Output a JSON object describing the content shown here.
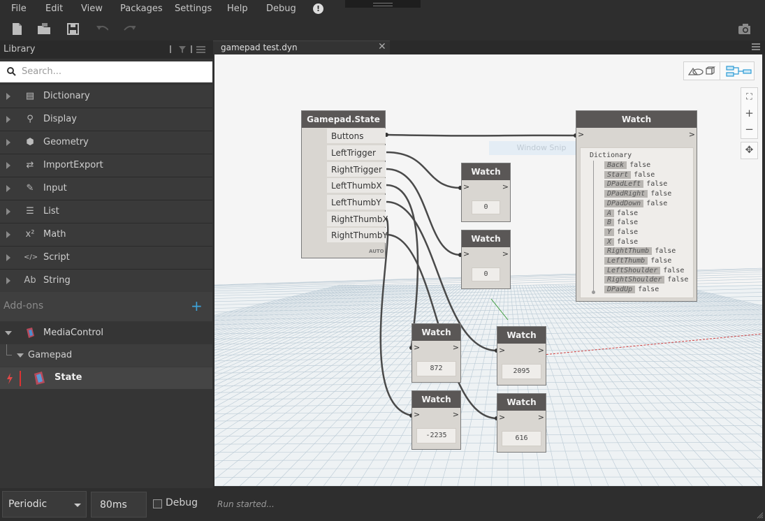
{
  "menu": {
    "items": [
      "File",
      "Edit",
      "View",
      "Packages",
      "Settings",
      "Help",
      "Debug"
    ],
    "alert_icon": "!"
  },
  "toolbar": {
    "icons": [
      "new-file-icon",
      "open-folder-icon",
      "save-icon",
      "undo-icon",
      "redo-icon",
      "camera-icon"
    ]
  },
  "library": {
    "title": "Library",
    "search_placeholder": "Search...",
    "categories": [
      {
        "label": "Dictionary",
        "icon": "▤"
      },
      {
        "label": "Display",
        "icon": "⚲"
      },
      {
        "label": "Geometry",
        "icon": "⬢"
      },
      {
        "label": "ImportExport",
        "icon": "⇄"
      },
      {
        "label": "Input",
        "icon": "✎"
      },
      {
        "label": "List",
        "icon": "☰"
      },
      {
        "label": "Math",
        "icon": "x²"
      },
      {
        "label": "Script",
        "icon": "</>"
      },
      {
        "label": "String",
        "icon": "Ab"
      }
    ],
    "addons_label": "Add-ons",
    "addon_package": "MediaControl",
    "addon_group": "Gamepad",
    "addon_node": "State"
  },
  "tab": {
    "label": "gamepad test.dyn",
    "close": "✕"
  },
  "canvas": {
    "snip_label": "Window Snip",
    "nodes": {
      "gamepad": {
        "title": "Gamepad.State",
        "outputs": [
          "Buttons",
          "LeftTrigger",
          "RightTrigger",
          "LeftThumbX",
          "LeftThumbY",
          "RightThumbX",
          "RightThumbY"
        ],
        "lacing": "AUTO"
      },
      "watches": [
        {
          "title": "Watch",
          "value": "0"
        },
        {
          "title": "Watch",
          "value": "0"
        },
        {
          "title": "Watch",
          "value": "872"
        },
        {
          "title": "Watch",
          "value": "2095"
        },
        {
          "title": "Watch",
          "value": "-2235"
        },
        {
          "title": "Watch",
          "value": "616"
        }
      ],
      "dict_watch": {
        "title": "Watch",
        "header": "Dictionary",
        "entries": [
          {
            "key": "Back",
            "value": "false"
          },
          {
            "key": "Start",
            "value": "false"
          },
          {
            "key": "DPadLeft",
            "value": "false"
          },
          {
            "key": "DPadRight",
            "value": "false"
          },
          {
            "key": "DPadDown",
            "value": "false"
          },
          {
            "key": "A",
            "value": "false"
          },
          {
            "key": "B",
            "value": "false"
          },
          {
            "key": "Y",
            "value": "false"
          },
          {
            "key": "X",
            "value": "false"
          },
          {
            "key": "RightThumb",
            "value": "false"
          },
          {
            "key": "LeftThumb",
            "value": "false"
          },
          {
            "key": "LeftShoulder",
            "value": "false"
          },
          {
            "key": "RightShoulder",
            "value": "false"
          },
          {
            "key": "DPadUp",
            "value": "false"
          }
        ]
      }
    },
    "port_in": ">",
    "port_out": ">"
  },
  "zoom": {
    "fit": "⛶",
    "in": "+",
    "out": "−",
    "pan": "✥"
  },
  "bottom": {
    "run_mode": "Periodic",
    "interval": "80ms",
    "debug_label": "Debug",
    "status": "Run started..."
  },
  "colors": {
    "accent": "#3ea3d9",
    "node_header": "#5a5756",
    "node_body": "#d9d6d1",
    "canvas": "#f5f5f5"
  }
}
